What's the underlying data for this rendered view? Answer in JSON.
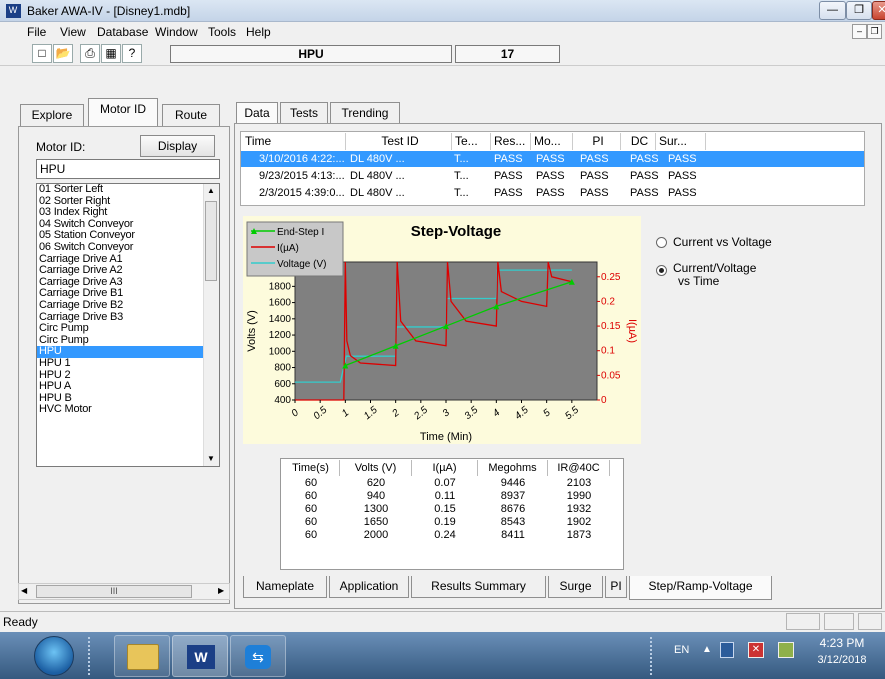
{
  "window": {
    "title": "Baker AWA-IV - [Disney1.mdb]",
    "app_icon": "W"
  },
  "menu": [
    "File",
    "View",
    "Database",
    "Window",
    "Tools",
    "Help"
  ],
  "toolbar": {
    "icons": [
      "new-file-icon",
      "open-folder-icon",
      "print-icon",
      "printer-setup-icon",
      "help-icon"
    ],
    "motor_field": "HPU",
    "count_field": "17"
  },
  "left_tabs": [
    "Explore",
    "Motor ID",
    "Route"
  ],
  "motor_panel": {
    "label": "Motor ID:",
    "display_button": "Display",
    "input_value": "HPU",
    "items": [
      "01 Sorter Left",
      "02 Sorter Right",
      "03 Index Right",
      "04 Switch Conveyor",
      "05 Station Conveyor",
      "06 Switch Conveyor",
      "Carriage Drive A1",
      "Carriage Drive A2",
      "Carriage Drive A3",
      "Carriage Drive B1",
      "Carriage Drive B2",
      "Carriage Drive B3",
      "Circ Pump",
      "Circ Pump",
      "HPU",
      "HPU 1",
      "HPU 2",
      "HPU A",
      "HPU B",
      "HVC Motor"
    ],
    "selected_index": 14,
    "hscroll_grip": "III"
  },
  "right_tabs": [
    "Data",
    "Tests",
    "Trending"
  ],
  "results": {
    "headers": [
      "Time",
      "Test ID",
      "Te...",
      "Res...",
      "Mo...",
      "PI",
      "DC",
      "Sur..."
    ],
    "rows": [
      {
        "time": "3/10/2016 4:22:...",
        "test_id": "DL 480V ...",
        "te": "T...",
        "res": "PASS",
        "mo": "PASS",
        "pi": "PASS",
        "dc": "PASS",
        "sur": "PASS",
        "selected": true
      },
      {
        "time": "9/23/2015 4:13:...",
        "test_id": "DL 480V ...",
        "te": "T...",
        "res": "PASS",
        "mo": "PASS",
        "pi": "PASS",
        "dc": "PASS",
        "sur": "PASS",
        "selected": false
      },
      {
        "time": "2/3/2015 4:39:0...",
        "test_id": "DL 480V ...",
        "te": "T...",
        "res": "PASS",
        "mo": "PASS",
        "pi": "PASS",
        "dc": "PASS",
        "sur": "PASS",
        "selected": false
      }
    ]
  },
  "chart_data": {
    "type": "line",
    "title": "Step-Voltage",
    "xlabel": "Time (Min)",
    "ylabel": "Volts (V)",
    "y2label": "I(µA)",
    "xlim": [
      0,
      6
    ],
    "ylim": [
      400,
      2100
    ],
    "y2lim": [
      0,
      0.28
    ],
    "x_ticks": [
      "0",
      "0.5",
      "1",
      "1.5",
      "2",
      "2.5",
      "3",
      "3.5",
      "4",
      "4.5",
      "5",
      "5.5"
    ],
    "y_ticks": [
      "2000",
      "1800",
      "1600",
      "1400",
      "1200",
      "1000",
      "800",
      "600",
      "400"
    ],
    "y2_ticks": [
      "0.25",
      "0.2",
      "0.15",
      "0.1",
      "0.05",
      "0"
    ],
    "legend": [
      {
        "name": "End-Step I",
        "color": "#00cc00"
      },
      {
        "name": "I(µA)",
        "color": "#dd0000"
      },
      {
        "name": "Voltage (V)",
        "color": "#33cccc"
      }
    ],
    "series": [
      {
        "name": "Voltage (V)",
        "color": "#33cccc",
        "x": [
          0,
          0.9,
          1.02,
          2.0,
          2.02,
          3.0,
          3.02,
          4.0,
          4.02,
          5.5
        ],
        "y": [
          620,
          620,
          940,
          940,
          1300,
          1300,
          1650,
          1650,
          2000,
          2000
        ]
      },
      {
        "name": "I(µA)",
        "color": "#dd0000",
        "x": [
          0,
          0.97,
          1.0,
          1.03,
          1.1,
          1.3,
          2.0,
          2.03,
          2.1,
          2.4,
          3.0,
          3.03,
          3.1,
          3.4,
          4.0,
          4.03,
          4.1,
          4.5,
          5.0,
          5.03,
          5.1,
          5.5
        ],
        "y": [
          0.0,
          0.0,
          0.28,
          0.12,
          0.09,
          0.075,
          0.07,
          0.28,
          0.16,
          0.12,
          0.11,
          0.28,
          0.2,
          0.16,
          0.15,
          0.28,
          0.22,
          0.2,
          0.19,
          0.28,
          0.25,
          0.24
        ]
      },
      {
        "name": "End-Step I",
        "color": "#00cc00",
        "x": [
          1.0,
          2.0,
          3.0,
          4.0,
          5.5
        ],
        "y": [
          0.07,
          0.11,
          0.15,
          0.19,
          0.24
        ]
      }
    ]
  },
  "options": {
    "radio1": "Current vs Voltage",
    "radio2_line1": "Current/Voltage",
    "radio2_line2": "vs Time",
    "selected": 2
  },
  "step_table": {
    "headers": [
      "Time(s)",
      "Volts (V)",
      "I(µA)",
      "Megohms",
      "IR@40C"
    ],
    "rows": [
      [
        "60",
        "620",
        "0.07",
        "9446",
        "2103"
      ],
      [
        "60",
        "940",
        "0.11",
        "8937",
        "1990"
      ],
      [
        "60",
        "1300",
        "0.15",
        "8676",
        "1932"
      ],
      [
        "60",
        "1650",
        "0.19",
        "8543",
        "1902"
      ],
      [
        "60",
        "2000",
        "0.24",
        "8411",
        "1873"
      ]
    ]
  },
  "bottom_tabs": [
    "Nameplate",
    "Application",
    "Results Summary",
    "Surge",
    "PI",
    "Step/Ramp-Voltage"
  ],
  "status": {
    "text": "Ready"
  },
  "taskbar": {
    "apps": [
      "explorer-icon",
      "baker-awa-icon",
      "teamviewer-icon"
    ],
    "lang": "EN",
    "time": "4:23 PM",
    "date": "3/12/2018"
  }
}
